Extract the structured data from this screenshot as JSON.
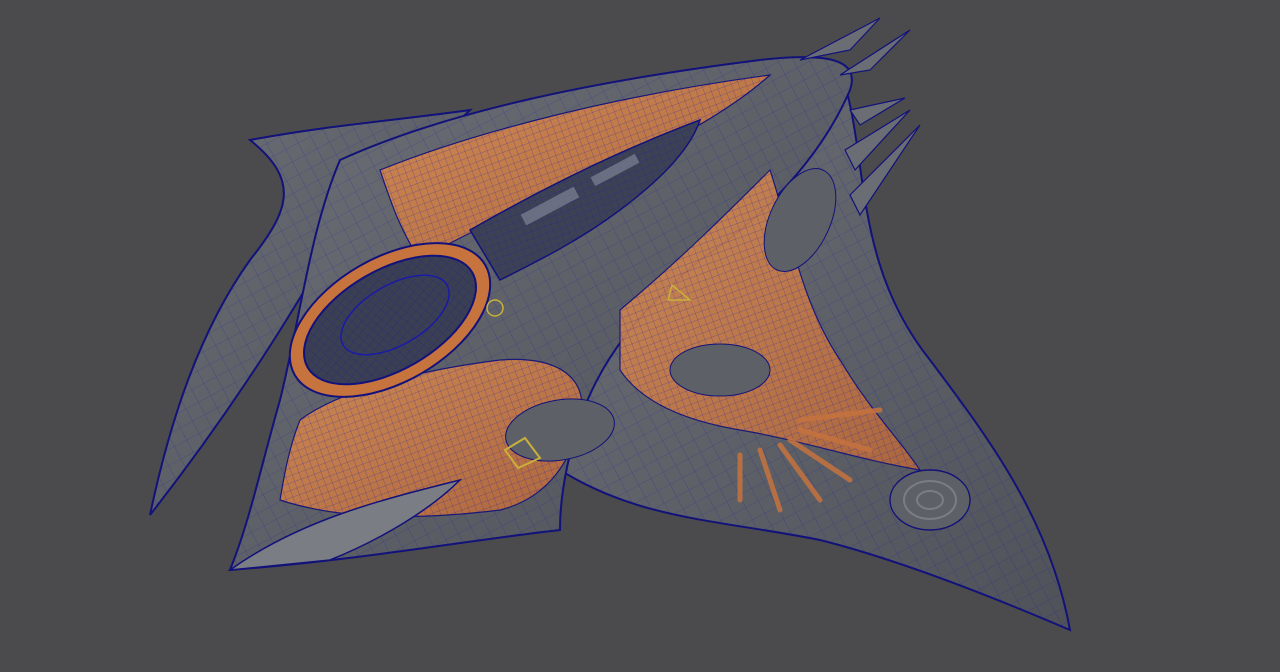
{
  "scene": {
    "description_visible_text": "",
    "colors": {
      "background": "#4b4b4d",
      "hull_gray": "#5d6066",
      "hull_gray_light": "#7a7d84",
      "orange": "#c6733e",
      "orange_light": "#d98d52",
      "wire": "#1a1aa8",
      "wire_dark": "#12127a",
      "cockpit_dark": "#2f3a52",
      "detail_yellow": "#c9b03a"
    }
  }
}
